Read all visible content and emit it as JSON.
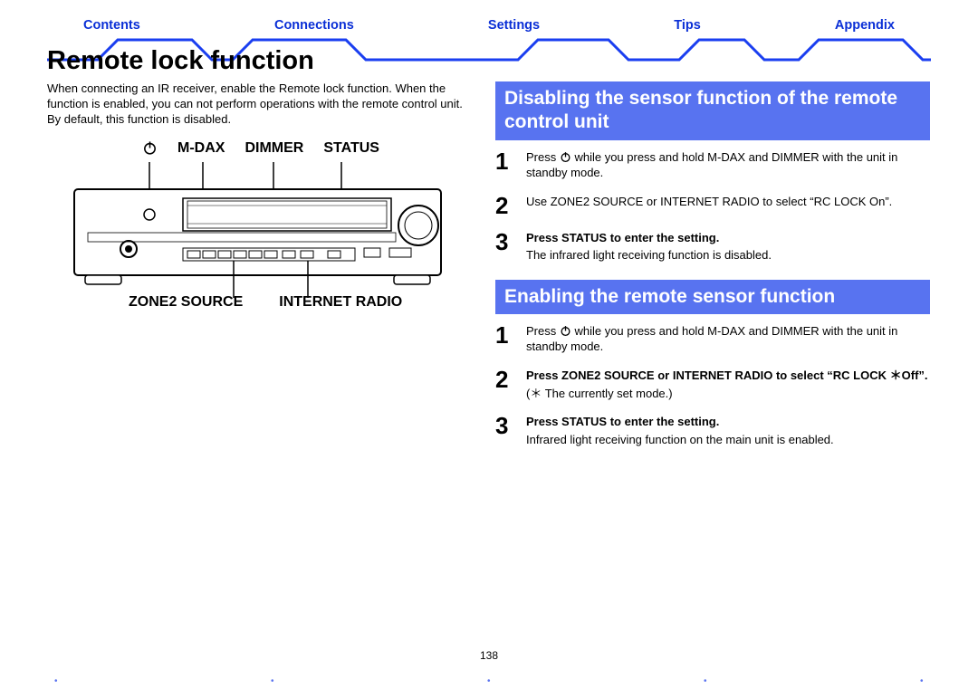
{
  "tabs": {
    "contents": "Contents",
    "connections": "Connections",
    "settings": "Settings",
    "tips": "Tips",
    "appendix": "Appendix"
  },
  "title": "Remote lock function",
  "intro1": "When connecting an IR receiver, enable the Remote lock function. When the function is enabled, you can not perform operations with the remote control unit.",
  "intro2": "By default, this function is disabled.",
  "labels_top": {
    "mdax": "M-DAX",
    "dimmer": "DIMMER",
    "status": "STATUS"
  },
  "labels_bottom": {
    "zone2": "ZONE2 SOURCE",
    "iradio": "INTERNET RADIO"
  },
  "sectionA_head": "Disabling the sensor function of the remote control unit",
  "sectionA": {
    "s1_a": "Press ",
    "s1_b": " while you press and hold M-DAX and DIMMER with the unit in standby mode.",
    "s2": "Use ZONE2 SOURCE or INTERNET RADIO to select “RC LOCK On”.",
    "s3": "Press STATUS to enter the setting.",
    "s3_note": "The infrared light receiving function is disabled."
  },
  "sectionB_head": "Enabling the remote sensor function",
  "sectionB": {
    "s1_a": "Press ",
    "s1_b": " while you press and hold M-DAX and DIMMER with the unit in standby mode.",
    "s2": "Press ZONE2 SOURCE or INTERNET RADIO to select “RC LOCK ＊Off”.",
    "s2_note": "(＊ The currently set mode.)",
    "s3": "Press STATUS to enter the setting.",
    "s3_note": "Infrared light receiving function on the main unit is enabled."
  },
  "pagenum": "138",
  "nums": {
    "one": "1",
    "two": "2",
    "three": "3"
  }
}
